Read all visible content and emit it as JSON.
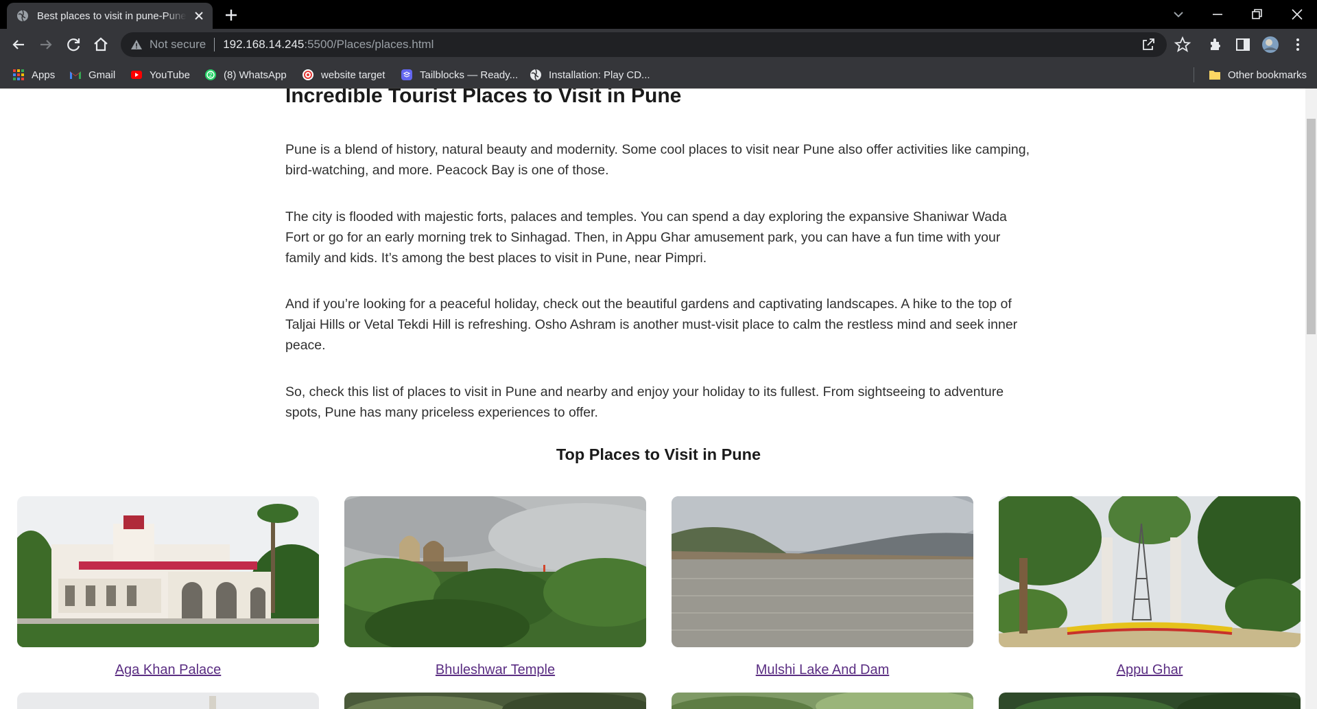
{
  "browser": {
    "tab_title": "Best places to visit in pune-Pune",
    "security_label": "Not secure",
    "url_host": "192.168.14.245",
    "url_path": ":5500/Places/places.html",
    "bookmarks": [
      {
        "label": "Apps",
        "icon": "apps-grid-icon"
      },
      {
        "label": "Gmail",
        "icon": "gmail-icon"
      },
      {
        "label": "YouTube",
        "icon": "youtube-icon"
      },
      {
        "label": "(8) WhatsApp",
        "icon": "whatsapp-icon"
      },
      {
        "label": "website target",
        "icon": "target-icon"
      },
      {
        "label": "Tailblocks — Ready...",
        "icon": "tailblocks-icon"
      },
      {
        "label": "Installation: Play CD...",
        "icon": "globe-icon"
      }
    ],
    "other_bookmarks": "Other bookmarks"
  },
  "page": {
    "heading": "Incredible Tourist Places to Visit in Pune",
    "paragraphs": [
      "Pune is a blend of history, natural beauty and modernity. Some cool places to visit near Pune also offer activities like camping, bird-watching, and more. Peacock Bay is one of those.",
      "The city is flooded with majestic forts, palaces and temples. You can spend a day exploring the expansive Shaniwar Wada Fort or go for an early morning trek to Sinhagad. Then, in Appu Ghar amusement park, you can have a fun time with your family and kids. It’s among the best places to visit in Pune, near Pimpri.",
      "And if you’re looking for a peaceful holiday, check out the beautiful gardens and captivating landscapes. A hike to the top of Taljai Hills or Vetal Tekdi Hill is refreshing. Osho Ashram is another must-visit place to calm the restless mind and seek inner peace.",
      "So, check this list of places to visit in Pune and nearby and enjoy your holiday to its fullest. From sightseeing to adventure spots, Pune has many priceless experiences to offer."
    ],
    "section_title": "Top Places to Visit in Pune",
    "places": [
      {
        "name": "Aga Khan Palace"
      },
      {
        "name": "Bhuleshwar Temple"
      },
      {
        "name": "Mulshi Lake And Dam"
      },
      {
        "name": "Appu Ghar"
      }
    ]
  },
  "colors": {
    "chrome_dark": "#202124",
    "tabstrip": "#000000",
    "toolbar": "#35363a",
    "link_visited": "#5a2d82"
  }
}
